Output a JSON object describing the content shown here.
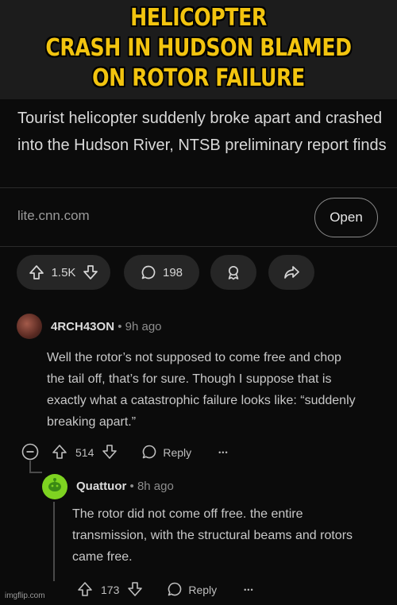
{
  "caption": {
    "line1": "HELICOPTER",
    "line2": "CRASH IN HUDSON BLAMED",
    "line3": "ON ROTOR FAILURE"
  },
  "post": {
    "headline": "Tourist helicopter suddenly broke apart and crashed into the Hudson River, NTSB preliminary report finds",
    "domain": "lite.cnn.com",
    "open_label": "Open",
    "votes": "1.5K",
    "comments": "198"
  },
  "comments": [
    {
      "author": "4RCH43ON",
      "separator": "•",
      "time": "9h ago",
      "body": "Well the rotor’s not supposed to come free and chop the tail off, that’s for sure.  Though I suppose that is exactly what a catastrophic failure looks like: “suddenly breaking apart.”",
      "votes": "514",
      "reply_label": "Reply",
      "more": "•••"
    },
    {
      "author": "Quattuor",
      "separator": "•",
      "time": "8h ago",
      "body": "The rotor did not come off free. the entire transmission, with the structural beams and rotors came free.",
      "votes": "173",
      "reply_label": "Reply",
      "more": "•••"
    }
  ],
  "watermark": "imgflip.com",
  "colors": {
    "caption": "#f2c40f",
    "pill_bg": "#262626",
    "page_bg": "#0b0b0b"
  }
}
